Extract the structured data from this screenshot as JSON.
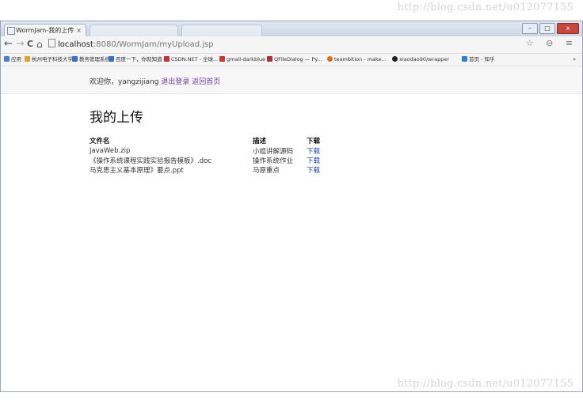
{
  "watermark": "http://blog.csdn.net/u012077155",
  "browser": {
    "tab_title": "WormJam-我的上传",
    "tab_close": "×",
    "url_host": "localhost",
    "url_path": ":8080/WormJam/myUpload.jsp",
    "nav_back": "←",
    "nav_forward": "→",
    "nav_reload": "C",
    "nav_home": "⌂",
    "window_minimize": "–",
    "window_maximize": "□",
    "window_close": "x",
    "toolbar_icons": "☆ ⊖ ≡",
    "bookmarks": [
      {
        "label": "应用",
        "color": "#4a7bd4"
      },
      {
        "label": "杭州电子科技大学",
        "color": "#e1a12a"
      },
      {
        "label": "教务管理系统",
        "color": "#3a6fd0"
      },
      {
        "label": "百度一下，你就知道",
        "color": "#3a6fd0"
      },
      {
        "label": "CSDN.NET - 全球...",
        "color": "#d0302a"
      },
      {
        "label": "gmail-darkblue",
        "color": "#c23a33"
      },
      {
        "label": "QFileDialog — Py...",
        "color": "#b0303a"
      },
      {
        "label": "teambition - make...",
        "color": "#e06a20"
      },
      {
        "label": "xiaodao90/wrapper",
        "color": "#222222"
      },
      {
        "label": "首页 - 知乎",
        "color": "#2f7fd6"
      }
    ],
    "bookmarks_more": "»"
  },
  "page": {
    "welcome_prefix": "欢迎你，yangzijiang",
    "logout_link": "退出登录",
    "home_link": "返回首页",
    "heading": "我的上传",
    "table": {
      "headers": [
        "文件名",
        "描述",
        "下载"
      ],
      "rows": [
        {
          "name": "JavaWeb.zip",
          "desc": "小组讲解源码",
          "download": "下载"
        },
        {
          "name": "《操作系统课程实践实验报告模板》.doc",
          "desc": "操作系统作业",
          "download": "下载"
        },
        {
          "name": "马克思主义基本原理》要点.ppt",
          "desc": "马原重点",
          "download": "下载"
        }
      ]
    }
  },
  "colors": {
    "link_visited": "#6b3fa0",
    "link": "#1a3fb0"
  }
}
